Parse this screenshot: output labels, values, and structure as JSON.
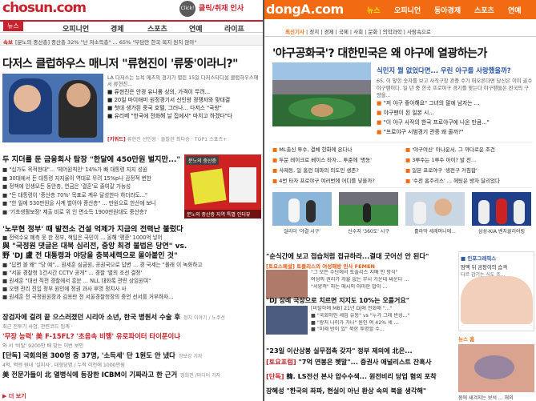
{
  "left": {
    "logo": "chosun.com",
    "click_badge": "Click!",
    "promo": "클릭/취재 인사",
    "nav_news": "뉴스",
    "nav": [
      "오피니언",
      "경제",
      "스포츠",
      "연예",
      "라이프"
    ],
    "ticker_label": "속보",
    "ticker": "[분노의 중산층] 중산층 32% \"난 저소득층\" ... 65% \"부담만 한국 복지 원치 않아\"",
    "headline": "다저스 클럽하우스 매니저 \"류현진이 '류뚱'이라니?\"",
    "intro": "LA 다저스는 뉴욕 메츠의 경기가 열린 15일 다저스타디움 클럽하우스에서 류현진...",
    "sub_items": [
      "■ 류현진은 안경 유니폼 상의, 가격이 무려...",
      "■ 20일 마이애미 원정경기서 신인왕 경쟁자와 맞대결",
      "■ 첫대 생가된 중국 호텔, 그러나... 다저스 \"국왕\"",
      "■ 유리베 \"한국에 전화해 날 집에서\" 마치고 하겠다\"다"
    ],
    "keyword_label": "[키워드]",
    "keywords": "류현진 선인왕 · 돌발한 최다승 · TOP1 스포츠+",
    "sec1_head": "두 지더를 둔 금융회사 탐장 \"한달에 450만원 벌지만...\"",
    "sec1_items": [
      "■ \"십가도 목적현대\"... '헤어원칙인' 14%가 빠 대통령 지지 성원",
      "■ 30대에서 돈 대통령 지지율이 역대로 무려 15%p나 감정적 변한",
      "■ 정책에 인생모든 동안층, 연금은 '결혼'로 줄여갈 가능성",
      "■ \"돈 대통령이 '중산층 70%' 목표로 계우 달성한다 하더라도...\"",
      "■ \"한 일에 530만원을 사계 벌어야 중산층\" ... 만원으로 한산에 보니",
      "■ '기초생활보장' 제출 비로 위 인 면소득 1900만원대도 중산층?"
    ],
    "side_tag": "분노의 중산층",
    "side_caption": "분노의 중산층 지역 특별 인터뷰",
    "sec2_head": "'노무현 정부' 때 발전소 건설 억제가 지금의 전력난 불렀다",
    "sec2_sub": "■ 전력수요 폐측 못 한 정부, 책임은 국민이 ... 올해 '평준' 1000억 넣어",
    "sec2_big1": "與 \"국정원 댓글은 대북 심리전, 중앙 최경 불법은 당연\" vs.",
    "sec2_big2": "野 'DJ 盧 전 대통령과 야당을 충북세력으로 몰아붙인 것\"",
    "sec2_items": [
      "■ \"답면 볼 왜\" \"당 얘\"... 원세훈 심금원, 공권국으로 답변 ... 경 국세는 \"몰래 이 녹화하고",
      "■ \"서울 경찰청 1건시간 CCTV 공개\" ... 경찰 '별의 조선 결정'",
      "■ 원세훈 \"대선 직전 경찰에서 흥분 ... NLL 대화록 관련 상임원여\"",
      "■ 오랜 관리 진입 정부 원인에 정권 과사 후명 정치사 사",
      "■ 원세훈 전 국정원원장과 김용판 전 서울경찰청장의 증언 선서를 거부하자..."
    ],
    "list3": [
      {
        "text": "장검자에 걸려 끝 으스러졌던 시리아 소년, 한국 병원서 수술 후",
        "src": "정치 이야기 / 노주선"
      },
      {
        "text": "'무장 능력' 美 F-15FL? '초음속 비행' 유로파이터 타이푼이냐",
        "src": ""
      },
      {
        "text": "[단독] 국회의원 300명 중 37명, '소득세' 단 1원도 안 냈다",
        "src": "정보강 기자"
      },
      {
        "text": "美 전문가들이 北 열병식에 등장한 ICBM이 기짜라고 한 근거",
        "src": "정희진 /미디어 기자"
      }
    ],
    "list3_meta": [
      "최근 전투기 사업, 관련코드 입계 ·",
      "와 서 '비탈' 9200만 배 맞는 이번 보인",
      "4억, 억엔 원내 '실지사', 대형당명 / 누적 이전에 1000만원",
      ""
    ],
    "foot": "▶ 더 보기"
  },
  "right": {
    "logo": "dongA.com",
    "nav": [
      "뉴스",
      "오피니언",
      "동아경제",
      "스포츠",
      "연예"
    ],
    "sub_nav": [
      "최신기사",
      "정치",
      "경제",
      "국제",
      "사회",
      "문화",
      "의학과학",
      "사람속으로"
    ],
    "title": "'야구공화국'? 대한민국은 왜 야구에 열광하는가",
    "lede_q": "식민지 뭘 없었다면... 우린 야구를 사랑했을까?",
    "lede_body": "65, 이 앞한 숫자를 보고 사직구장 관중 수가 떠오른다면 당신은 이미 골수 야구팬이다. 일 년 중 한국 프로야구 경기를 맞는다 야구팬들은 전국의 구장을...",
    "bullets": [
      "\"저 야구 좋아해요\" 그녀의 말에 남자는 ...",
      "야구팬이 된 일본 시...",
      "\"이 야구 사작의 한국 프로야구에 나온 만큼...\"",
      "\"프로야구 시범경기 관중 왜 줄까?\""
    ],
    "grid": [
      "ML출신 투수, 결체 한화에 온다나",
      "'야구여신' 아나운서, 그 까다로운 조건",
      "두문 레이크로 베이스 타자... 투준에 '명동'",
      "3루수는 1루수 아이? 발 전...",
      "사제동, 일 홈런 대마의 의도민 생존?",
      "일본 프로야구 '생전구 거침합'",
      "4번 타자 프로야구 여러번에 어디를 넣을까?",
      "'수전 홈주리스' ... 헤팅은 방자 달리었다"
    ],
    "thumbs": [
      {
        "cap": "얼리더 '야결 시구'",
        "bg": "#8bb5d9"
      },
      {
        "cap": "신수지 '360도' 시구",
        "bg": "#3d8a43"
      },
      {
        "cap": "훌라딱 세레머니에...",
        "bg": "#c9d7e5"
      },
      {
        "cap": "삼성-KIA 벤치클리어링",
        "bg": "#1f3f8a"
      }
    ],
    "lower_title": "\"순식간에 보고 접습처럼 접규하라...결대 굿어선 안 된다\"",
    "blocks": [
      {
        "tag": "[토요스페셜] 토플리스의 여성해방 인사 FEMEN",
        "lines": [
          "\"그 모든 수단에서 토플리스 지배 인 방식\"",
          "여성의 권리가 자율 없는 무시 가운데 싸운다 ...",
          "\"서양적\" 하는 메시의 아마한 밥이 ..."
        ]
      },
      {
        "tag": "\"DJ 장례 국장으로 치르면 지지도 10%는 오를거요\"",
        "lines": [
          "[비탈하에 MB] 21년 DJ에 전화해 \"...\"",
          "■ \"국회하인 세입 유동\" vs \"누가 그래 반성...\"",
          "■ \"왕처 나이가 가나\" 원인 여 42% 세 ...",
          "■ \"미제 반이 있\" 북한 투명할 수..."
        ]
      }
    ],
    "big_lines": [
      {
        "tag": "",
        "text": "\"23일 이산상봉 실무접촉 갖자\" 정부 제의에 北은..."
      },
      {
        "tag": "[토요포럼]",
        "text": "\"7억 연봉은 혯말\"... 증권사 애널리스트 잔혹사"
      },
      {
        "tag": "[단독]",
        "text": "韓. LS전선 본사 압수수색... 원전비리 당업 혐의 포착"
      },
      {
        "tag": "",
        "text": "장혜성 \"한국의 좌파, 현실이 아닌 환상 속의 북을 생각해\""
      }
    ],
    "side_box_hd": "■ 인포그래픽스",
    "side_box_t1": "잠맥 뒤 곰팡이의 습격",
    "side_box_t2": "다르 감기는 식도 조...",
    "side_news_hd": "뉴스 홈",
    "side_news_cap": "몸에 새겨지는 보석 ... 해외"
  }
}
